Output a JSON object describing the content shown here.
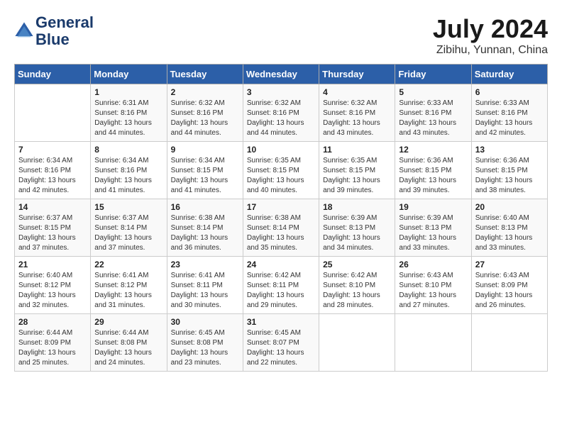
{
  "header": {
    "logo_line1": "General",
    "logo_line2": "Blue",
    "month_year": "July 2024",
    "location": "Zibihu, Yunnan, China"
  },
  "weekdays": [
    "Sunday",
    "Monday",
    "Tuesday",
    "Wednesday",
    "Thursday",
    "Friday",
    "Saturday"
  ],
  "weeks": [
    [
      {
        "day": "",
        "sunrise": "",
        "sunset": "",
        "daylight": ""
      },
      {
        "day": "1",
        "sunrise": "Sunrise: 6:31 AM",
        "sunset": "Sunset: 8:16 PM",
        "daylight": "Daylight: 13 hours and 44 minutes."
      },
      {
        "day": "2",
        "sunrise": "Sunrise: 6:32 AM",
        "sunset": "Sunset: 8:16 PM",
        "daylight": "Daylight: 13 hours and 44 minutes."
      },
      {
        "day": "3",
        "sunrise": "Sunrise: 6:32 AM",
        "sunset": "Sunset: 8:16 PM",
        "daylight": "Daylight: 13 hours and 44 minutes."
      },
      {
        "day": "4",
        "sunrise": "Sunrise: 6:32 AM",
        "sunset": "Sunset: 8:16 PM",
        "daylight": "Daylight: 13 hours and 43 minutes."
      },
      {
        "day": "5",
        "sunrise": "Sunrise: 6:33 AM",
        "sunset": "Sunset: 8:16 PM",
        "daylight": "Daylight: 13 hours and 43 minutes."
      },
      {
        "day": "6",
        "sunrise": "Sunrise: 6:33 AM",
        "sunset": "Sunset: 8:16 PM",
        "daylight": "Daylight: 13 hours and 42 minutes."
      }
    ],
    [
      {
        "day": "7",
        "sunrise": "Sunrise: 6:34 AM",
        "sunset": "Sunset: 8:16 PM",
        "daylight": "Daylight: 13 hours and 42 minutes."
      },
      {
        "day": "8",
        "sunrise": "Sunrise: 6:34 AM",
        "sunset": "Sunset: 8:16 PM",
        "daylight": "Daylight: 13 hours and 41 minutes."
      },
      {
        "day": "9",
        "sunrise": "Sunrise: 6:34 AM",
        "sunset": "Sunset: 8:15 PM",
        "daylight": "Daylight: 13 hours and 41 minutes."
      },
      {
        "day": "10",
        "sunrise": "Sunrise: 6:35 AM",
        "sunset": "Sunset: 8:15 PM",
        "daylight": "Daylight: 13 hours and 40 minutes."
      },
      {
        "day": "11",
        "sunrise": "Sunrise: 6:35 AM",
        "sunset": "Sunset: 8:15 PM",
        "daylight": "Daylight: 13 hours and 39 minutes."
      },
      {
        "day": "12",
        "sunrise": "Sunrise: 6:36 AM",
        "sunset": "Sunset: 8:15 PM",
        "daylight": "Daylight: 13 hours and 39 minutes."
      },
      {
        "day": "13",
        "sunrise": "Sunrise: 6:36 AM",
        "sunset": "Sunset: 8:15 PM",
        "daylight": "Daylight: 13 hours and 38 minutes."
      }
    ],
    [
      {
        "day": "14",
        "sunrise": "Sunrise: 6:37 AM",
        "sunset": "Sunset: 8:15 PM",
        "daylight": "Daylight: 13 hours and 37 minutes."
      },
      {
        "day": "15",
        "sunrise": "Sunrise: 6:37 AM",
        "sunset": "Sunset: 8:14 PM",
        "daylight": "Daylight: 13 hours and 37 minutes."
      },
      {
        "day": "16",
        "sunrise": "Sunrise: 6:38 AM",
        "sunset": "Sunset: 8:14 PM",
        "daylight": "Daylight: 13 hours and 36 minutes."
      },
      {
        "day": "17",
        "sunrise": "Sunrise: 6:38 AM",
        "sunset": "Sunset: 8:14 PM",
        "daylight": "Daylight: 13 hours and 35 minutes."
      },
      {
        "day": "18",
        "sunrise": "Sunrise: 6:39 AM",
        "sunset": "Sunset: 8:13 PM",
        "daylight": "Daylight: 13 hours and 34 minutes."
      },
      {
        "day": "19",
        "sunrise": "Sunrise: 6:39 AM",
        "sunset": "Sunset: 8:13 PM",
        "daylight": "Daylight: 13 hours and 33 minutes."
      },
      {
        "day": "20",
        "sunrise": "Sunrise: 6:40 AM",
        "sunset": "Sunset: 8:13 PM",
        "daylight": "Daylight: 13 hours and 33 minutes."
      }
    ],
    [
      {
        "day": "21",
        "sunrise": "Sunrise: 6:40 AM",
        "sunset": "Sunset: 8:12 PM",
        "daylight": "Daylight: 13 hours and 32 minutes."
      },
      {
        "day": "22",
        "sunrise": "Sunrise: 6:41 AM",
        "sunset": "Sunset: 8:12 PM",
        "daylight": "Daylight: 13 hours and 31 minutes."
      },
      {
        "day": "23",
        "sunrise": "Sunrise: 6:41 AM",
        "sunset": "Sunset: 8:11 PM",
        "daylight": "Daylight: 13 hours and 30 minutes."
      },
      {
        "day": "24",
        "sunrise": "Sunrise: 6:42 AM",
        "sunset": "Sunset: 8:11 PM",
        "daylight": "Daylight: 13 hours and 29 minutes."
      },
      {
        "day": "25",
        "sunrise": "Sunrise: 6:42 AM",
        "sunset": "Sunset: 8:10 PM",
        "daylight": "Daylight: 13 hours and 28 minutes."
      },
      {
        "day": "26",
        "sunrise": "Sunrise: 6:43 AM",
        "sunset": "Sunset: 8:10 PM",
        "daylight": "Daylight: 13 hours and 27 minutes."
      },
      {
        "day": "27",
        "sunrise": "Sunrise: 6:43 AM",
        "sunset": "Sunset: 8:09 PM",
        "daylight": "Daylight: 13 hours and 26 minutes."
      }
    ],
    [
      {
        "day": "28",
        "sunrise": "Sunrise: 6:44 AM",
        "sunset": "Sunset: 8:09 PM",
        "daylight": "Daylight: 13 hours and 25 minutes."
      },
      {
        "day": "29",
        "sunrise": "Sunrise: 6:44 AM",
        "sunset": "Sunset: 8:08 PM",
        "daylight": "Daylight: 13 hours and 24 minutes."
      },
      {
        "day": "30",
        "sunrise": "Sunrise: 6:45 AM",
        "sunset": "Sunset: 8:08 PM",
        "daylight": "Daylight: 13 hours and 23 minutes."
      },
      {
        "day": "31",
        "sunrise": "Sunrise: 6:45 AM",
        "sunset": "Sunset: 8:07 PM",
        "daylight": "Daylight: 13 hours and 22 minutes."
      },
      {
        "day": "",
        "sunrise": "",
        "sunset": "",
        "daylight": ""
      },
      {
        "day": "",
        "sunrise": "",
        "sunset": "",
        "daylight": ""
      },
      {
        "day": "",
        "sunrise": "",
        "sunset": "",
        "daylight": ""
      }
    ]
  ]
}
